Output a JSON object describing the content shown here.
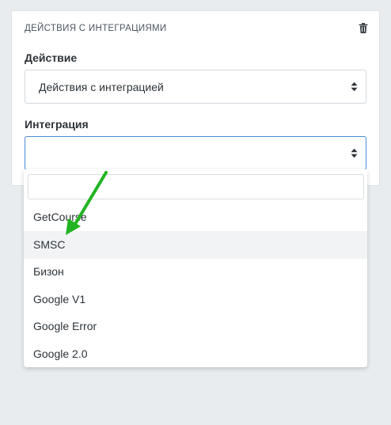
{
  "card": {
    "title": "ДЕЙСТВИЯ С ИНТЕГРАЦИЯМИ",
    "delete_icon": "trash-icon"
  },
  "action": {
    "label": "Действие",
    "value": "Действия с интеграцией"
  },
  "integration": {
    "label": "Интеграция",
    "value": "",
    "search_placeholder": ""
  },
  "dropdown": {
    "options": [
      "GetCourse",
      "SMSC",
      "Бизон",
      "Google V1",
      "Google Error",
      "Google 2.0"
    ],
    "highlighted": "SMSC"
  },
  "colors": {
    "focus_border": "#4a8bd6",
    "annotation_arrow": "#22b422"
  }
}
